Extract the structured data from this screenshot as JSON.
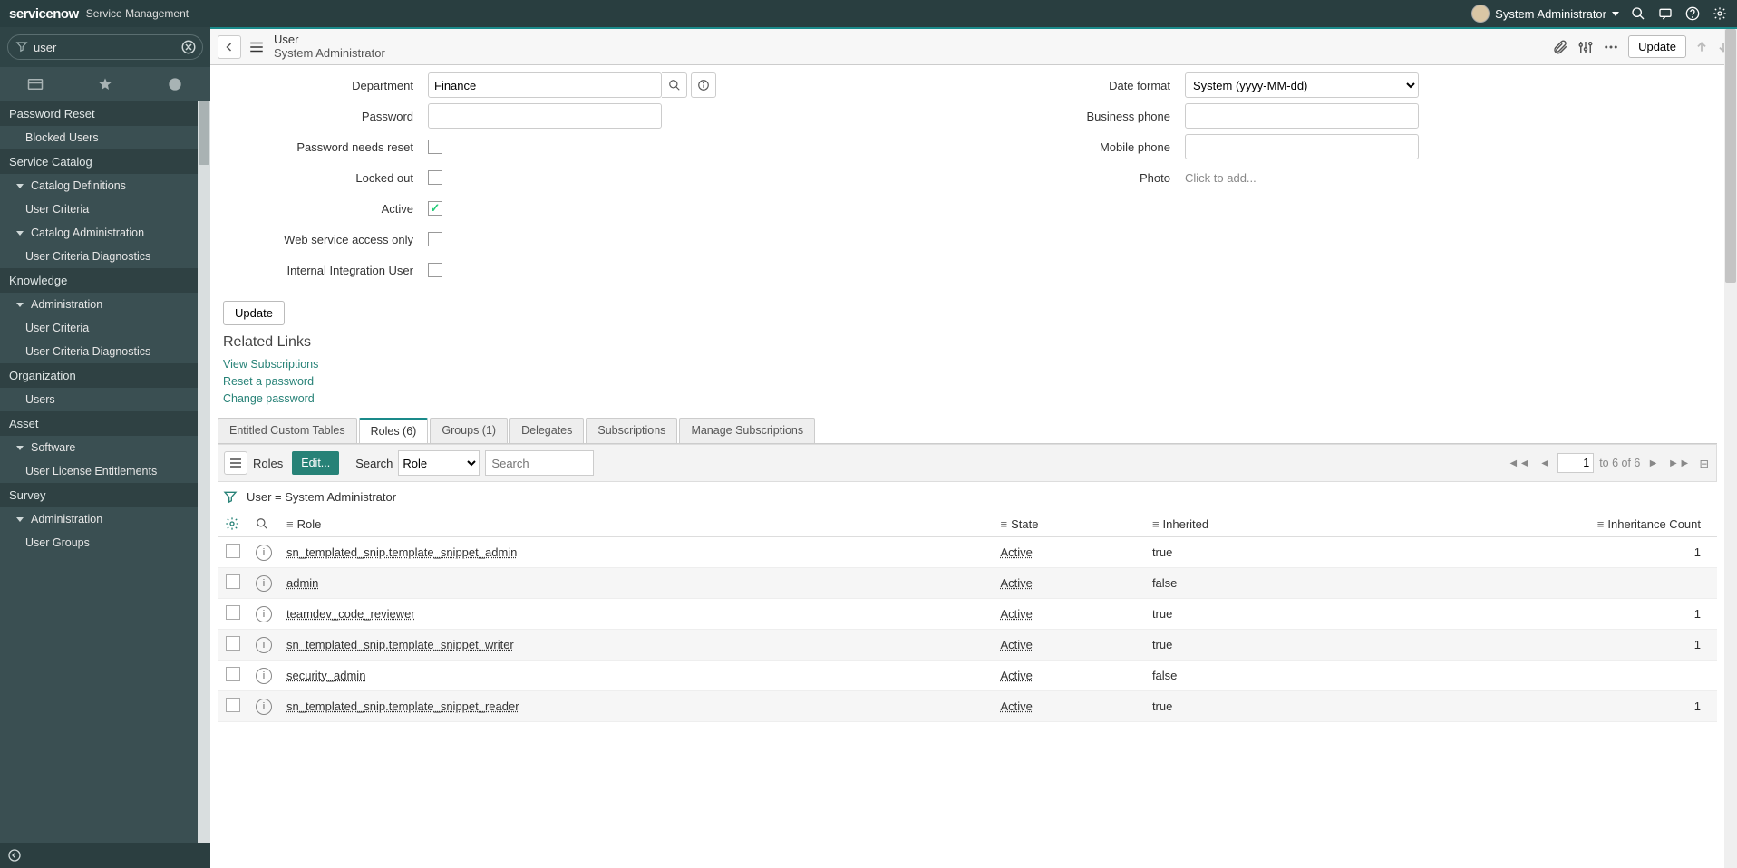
{
  "banner": {
    "product": "servicenow",
    "suite": "Service Management",
    "user_name": "System Administrator"
  },
  "nav": {
    "filter_value": "user",
    "tree": [
      {
        "type": "app",
        "label": "Password Reset"
      },
      {
        "type": "mod",
        "label": "Blocked Users"
      },
      {
        "type": "app",
        "label": "Service Catalog"
      },
      {
        "type": "group",
        "label": "Catalog Definitions"
      },
      {
        "type": "mod",
        "label": "User Criteria"
      },
      {
        "type": "group",
        "label": "Catalog Administration"
      },
      {
        "type": "mod",
        "label": "User Criteria Diagnostics"
      },
      {
        "type": "app",
        "label": "Knowledge"
      },
      {
        "type": "group",
        "label": "Administration"
      },
      {
        "type": "mod",
        "label": "User Criteria"
      },
      {
        "type": "mod",
        "label": "User Criteria Diagnostics"
      },
      {
        "type": "app",
        "label": "Organization"
      },
      {
        "type": "mod",
        "label": "Users"
      },
      {
        "type": "app",
        "label": "Asset"
      },
      {
        "type": "group",
        "label": "Software"
      },
      {
        "type": "mod",
        "label": "User License Entitlements"
      },
      {
        "type": "app",
        "label": "Survey"
      },
      {
        "type": "group",
        "label": "Administration"
      },
      {
        "type": "mod",
        "label": "User Groups"
      }
    ]
  },
  "form_header": {
    "table_label": "User",
    "display_value": "System Administrator",
    "update_label": "Update"
  },
  "form": {
    "left": {
      "department_label": "Department",
      "department_value": "Finance",
      "password_label": "Password",
      "password_value": "",
      "needs_reset_label": "Password needs reset",
      "needs_reset_value": false,
      "locked_out_label": "Locked out",
      "locked_out_value": false,
      "active_label": "Active",
      "active_value": true,
      "ws_only_label": "Web service access only",
      "ws_only_value": false,
      "internal_label": "Internal Integration User",
      "internal_value": false
    },
    "right": {
      "date_format_label": "Date format",
      "date_format_value": "System (yyyy-MM-dd)",
      "business_phone_label": "Business phone",
      "business_phone_value": "",
      "mobile_phone_label": "Mobile phone",
      "mobile_phone_value": "",
      "photo_label": "Photo",
      "photo_value": "Click to add..."
    },
    "update_btn": "Update"
  },
  "related_links": {
    "heading": "Related Links",
    "links": [
      "View Subscriptions",
      "Reset a password",
      "Change password"
    ]
  },
  "tabs": [
    "Entitled Custom Tables",
    "Roles (6)",
    "Groups (1)",
    "Delegates",
    "Subscriptions",
    "Manage Subscriptions"
  ],
  "list": {
    "title": "Roles",
    "edit_label": "Edit...",
    "search_label": "Search",
    "search_field": "Role",
    "search_placeholder": "Search",
    "breadcrumb": "User = System Administrator",
    "pager": {
      "page": "1",
      "range": "to 6 of 6",
      "range2": "to 6 of 6"
    },
    "columns": [
      "Role",
      "State",
      "Inherited",
      "Inheritance Count"
    ],
    "rows": [
      {
        "role": "sn_templated_snip.template_snippet_admin",
        "state": "Active",
        "inherited": "true",
        "count": "1"
      },
      {
        "role": "admin",
        "state": "Active",
        "inherited": "false",
        "count": ""
      },
      {
        "role": "teamdev_code_reviewer",
        "state": "Active",
        "inherited": "true",
        "count": "1"
      },
      {
        "role": "sn_templated_snip.template_snippet_writer",
        "state": "Active",
        "inherited": "true",
        "count": "1"
      },
      {
        "role": "security_admin",
        "state": "Active",
        "inherited": "false",
        "count": ""
      },
      {
        "role": "sn_templated_snip.template_snippet_reader",
        "state": "Active",
        "inherited": "true",
        "count": "1"
      }
    ]
  }
}
